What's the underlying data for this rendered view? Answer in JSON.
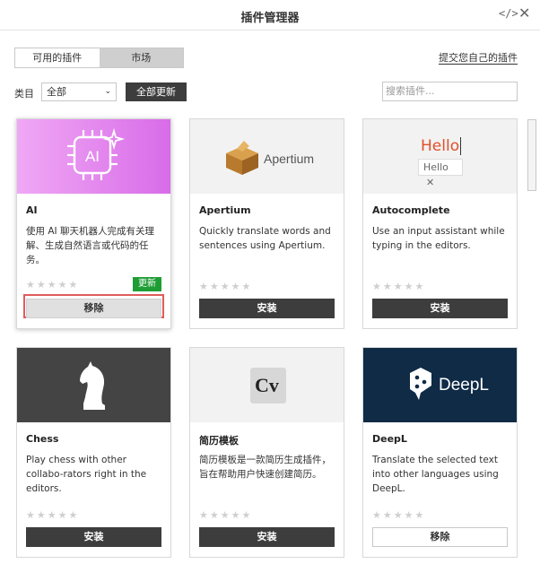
{
  "window": {
    "title": "插件管理器",
    "code_icon": "code-icon",
    "close_icon": "close-icon"
  },
  "tabs": [
    {
      "label": "可用的插件",
      "active": false
    },
    {
      "label": "市场",
      "active": true
    }
  ],
  "submit_link": "提交您自己的插件",
  "filter": {
    "category_label": "类目",
    "category_value": "全部",
    "update_all": "全部更新",
    "search_placeholder": "搜索插件..."
  },
  "plugins": [
    {
      "name": "AI",
      "description": "使用 AI 聊天机器人完成有关理解、生成自然语言或代码的任务。",
      "action": "移除",
      "badge": "更新",
      "thumb_icon": "ai-chip-icon",
      "thumb_text": "AI"
    },
    {
      "name": "Apertium",
      "description": "Quickly translate words and sentences using Apertium.",
      "action": "安装",
      "thumb_text": "Apertium",
      "thumb_icon": "box-icon"
    },
    {
      "name": "Autocomplete",
      "description": "Use an input assistant while typing in the editors.",
      "action": "安装",
      "thumb_text": "Hello",
      "thumb_chip": "Hello"
    },
    {
      "name": "Chess",
      "description": "Play chess with other collabo-rators right in the editors.",
      "action": "安装",
      "thumb_icon": "chess-knight-icon"
    },
    {
      "name": "简历模板",
      "description": "简历模板是一款简历生成插件，旨在帮助用户快速创建简历。",
      "action": "安装",
      "thumb_text": "Cv"
    },
    {
      "name": "DeepL",
      "description": "Translate the selected text into other languages using DeepL.",
      "action": "移除",
      "thumb_text": "DeepL",
      "thumb_icon": "deepl-icon"
    }
  ],
  "rating_stars": "★★★★★",
  "colors": {
    "accent_red": "#e05c5c",
    "badge_green": "#1f9d35",
    "dark_button": "#3d3d3d",
    "deepl_navy": "#0f2b46"
  }
}
